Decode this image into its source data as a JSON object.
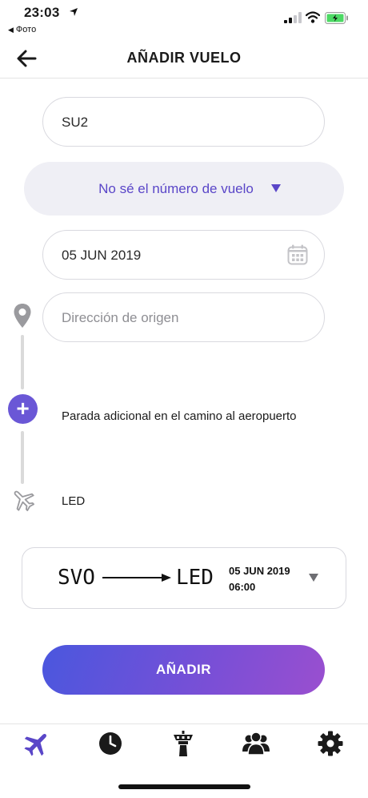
{
  "status_bar": {
    "time": "23:03",
    "back_app_label": "Фото"
  },
  "header": {
    "title": "AÑADIR VUELO"
  },
  "form": {
    "flight_number_value": "SU2",
    "unknown_flight_label": "No sé el número de vuelo",
    "date_value": "05 JUN 2019",
    "origin_placeholder": "Dirección de origen",
    "stop_label": "Parada adicional en el camino al aeropuerto",
    "destination_label": "LED"
  },
  "flight_card": {
    "from": "SVO",
    "to": "LED",
    "date": "05 JUN 2019",
    "time": "06:00"
  },
  "submit_label": "AÑADIR",
  "colors": {
    "accent": "#5a46c8",
    "button_gradient_start": "#4a57de",
    "button_gradient_end": "#9a4fcf",
    "battery": "#4cd964"
  },
  "tabs": [
    {
      "icon": "plane-icon",
      "active": true
    },
    {
      "icon": "clock-icon",
      "active": false
    },
    {
      "icon": "control-tower-icon",
      "active": false
    },
    {
      "icon": "group-icon",
      "active": false
    },
    {
      "icon": "gear-icon",
      "active": false
    }
  ]
}
